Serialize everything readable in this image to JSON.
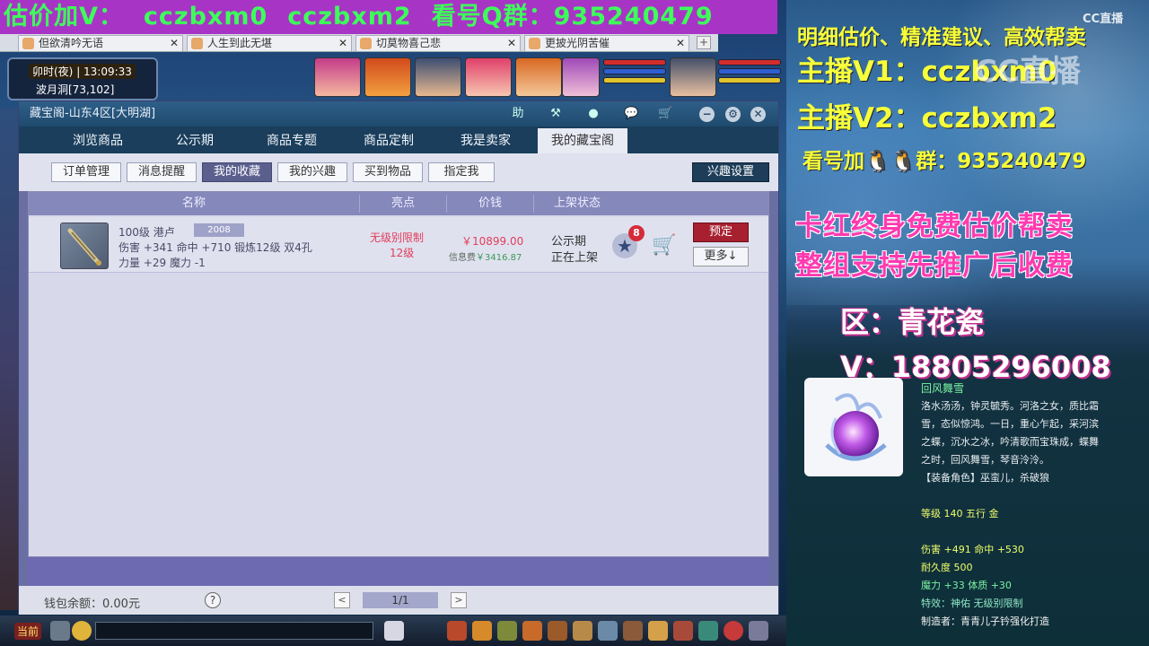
{
  "banner": {
    "contact_label": "估价加V：",
    "id1": "cczbxm0",
    "id2": "cczbxm2",
    "group_label": "看号Q群：",
    "group_no": "935240479"
  },
  "browser_tabs": [
    {
      "title": "但欲清吟无语"
    },
    {
      "title": "人生到此无堪"
    },
    {
      "title": "切莫物喜己悲"
    },
    {
      "title": "更披光阴苦催"
    }
  ],
  "browser_tab_new": "+",
  "game_hud": {
    "time_label": "卯时(夜)",
    "clock": "13:09:33",
    "location": "波月洞[73,102]"
  },
  "shop": {
    "title": "藏宝阁-山东4区[大明湖]",
    "title_icons": [
      "help-icon",
      "hammer-icon",
      "record-icon",
      "chat-icon",
      "cart-icon"
    ],
    "help_char": "助",
    "window_buttons": [
      "minimize-button",
      "settings-button",
      "close-button"
    ],
    "main_tabs": [
      "浏览商品",
      "公示期",
      "商品专题",
      "商品定制",
      "我是卖家",
      "我的藏宝阁"
    ],
    "active_main_tab": "我的藏宝阁",
    "search_placeholder": "",
    "sub_tabs": [
      "订单管理",
      "消息提醒",
      "我的收藏",
      "我的兴趣",
      "买到物品",
      "指定我"
    ],
    "active_sub_tab": "我的收藏",
    "interest_settings_label": "兴趣设置",
    "columns": [
      "名称",
      "亮点",
      "价钱",
      "上架状态"
    ],
    "items": [
      {
        "level_name": "100级 港卢",
        "badge": "2008",
        "stats_line": "伤害 +341 命中 +710 锻炼12级 双4孔",
        "stats_line2": "力量 +29 魔力 -1",
        "highlight1": "无级别限制",
        "highlight2": "12级",
        "price": "￥10899.00",
        "fee_label": "信息费",
        "fee": "￥3416.87",
        "status1": "公示期",
        "status2": "正在上架",
        "fav_count": "8",
        "reserve_label": "预定",
        "more_label": "更多↓"
      }
    ],
    "balance_label": "钱包余额：0.00元",
    "help_mark": "?",
    "page": "1/1",
    "prev": "<",
    "next": ">"
  },
  "bottom_bar": {
    "now_label": "当前"
  },
  "stream_panel": {
    "line1": "明细估价、精准建议、高效帮卖",
    "cc_logo": "CC直播",
    "line2": "主播V1：cczbxm0",
    "watermark": "CC直播",
    "line3": "主播V2：cczbxm2",
    "line4": "看号加🐧🐧群：935240479",
    "line5": "卡红终身免费估价帮卖",
    "line6": "整组支持先推广后收费",
    "line7": "区：青花瓷",
    "line8": "V：18805296008",
    "item_name": "回风舞雪",
    "desc": [
      "洛水汤汤，钟灵毓秀。河洛之女，质比霜",
      "雪，态似惊鸿。一日，重心乍起，采河滨",
      "之蝶，沉水之冰，吟清歌而宝珠成，蝶舞",
      "之时，回风舞雪，琴音泠泠。",
      "【装备角色】巫蛮儿，杀破狼"
    ],
    "level_line": "等级 140  五行 金",
    "stat1": "伤害 +491 命中 +530",
    "stat2": "耐久度 500",
    "stat3": "魔力 +33 体质 +30",
    "stat4": "特效：神佑 无级别限制",
    "stat5": "制造者：青青儿子钤强化打造"
  },
  "colors": {
    "banner_bg": "#a834c6",
    "banner_text": "#3dff5a",
    "panel_yellow": "#f6ff3a",
    "panel_pink": "#ff3ab0",
    "reserve_red": "#a7202f",
    "highlight_red": "#e03e5a"
  }
}
